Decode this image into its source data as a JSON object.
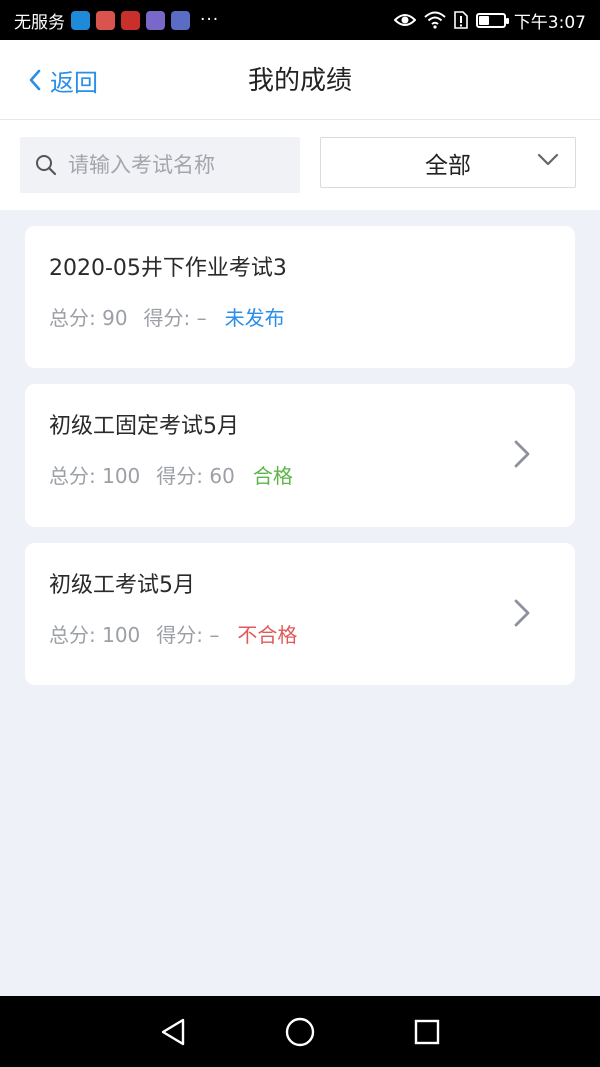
{
  "status_bar": {
    "carrier": "无服务",
    "time": "下午3:07",
    "dots": "···",
    "battery_level": 0.4,
    "app_icon_colors": [
      "#1e8ad8",
      "#d9534f",
      "#c9302c",
      "#7a68c9",
      "#5b6cc4"
    ]
  },
  "header": {
    "back_label": "返回",
    "title": "我的成绩"
  },
  "filter": {
    "search_placeholder": "请输入考试名称",
    "search_value": "",
    "select_value": "全部"
  },
  "results": [
    {
      "title": "2020-05井下作业考试3",
      "total_label": "总分: 90",
      "score_label": "得分: –",
      "status": "未发布",
      "status_color": "#2b8ee8",
      "has_arrow": false
    },
    {
      "title": "初级工固定考试5月",
      "total_label": "总分: 100",
      "score_label": "得分: 60",
      "status": "合格",
      "status_color": "#5cb548",
      "has_arrow": true
    },
    {
      "title": "初级工考试5月",
      "total_label": "总分: 100",
      "score_label": "得分: –",
      "status": "不合格",
      "status_color": "#e05a5a",
      "has_arrow": true
    }
  ],
  "colors": {
    "accent": "#2b8ee8",
    "background": "#eef1f8"
  }
}
